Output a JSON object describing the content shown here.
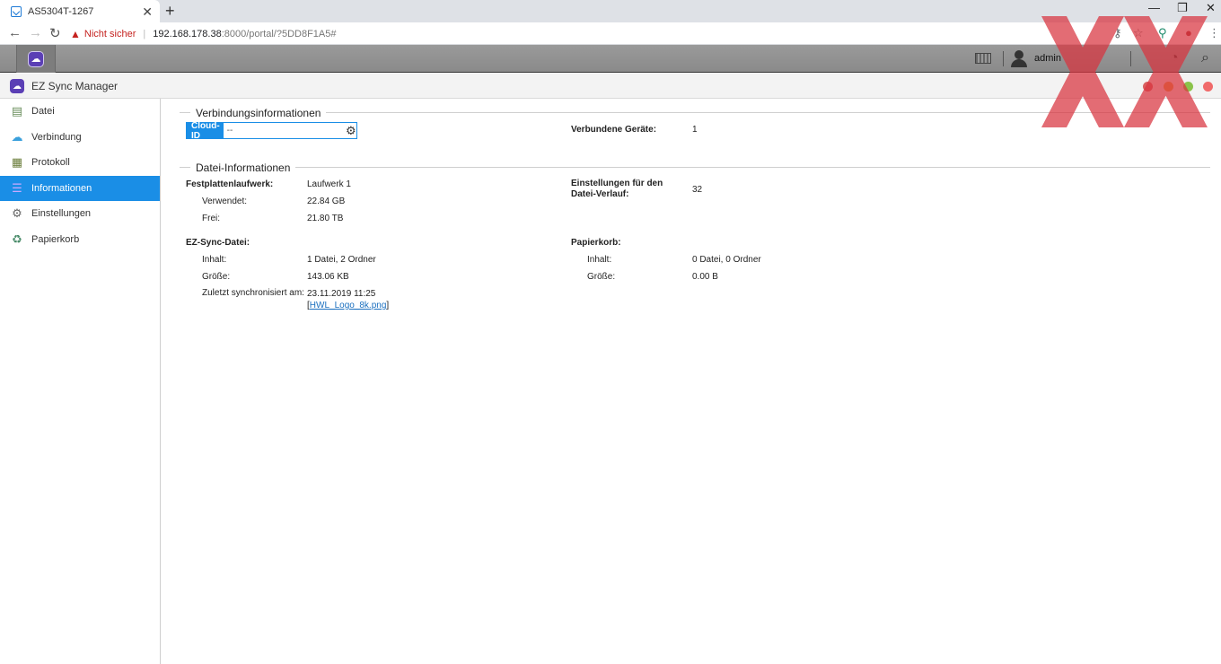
{
  "browser": {
    "tab_title": "AS5304T-1267",
    "security_label": "Nicht sicher",
    "url_host": "192.168.178.38",
    "url_path": ":8000/portal/?5DD8F1A5#"
  },
  "nas": {
    "username": "admin"
  },
  "app": {
    "title": "EZ Sync Manager"
  },
  "sidebar": {
    "items": [
      {
        "label": "Datei",
        "icon": "document-icon"
      },
      {
        "label": "Verbindung",
        "icon": "cloud-icon"
      },
      {
        "label": "Protokoll",
        "icon": "clipboard-icon"
      },
      {
        "label": "Informationen",
        "icon": "list-icon"
      },
      {
        "label": "Einstellungen",
        "icon": "gear-icon"
      },
      {
        "label": "Papierkorb",
        "icon": "recycle-icon"
      }
    ]
  },
  "connection": {
    "title": "Verbindungsinformationen",
    "cloud_id_label": "Cloud-ID",
    "cloud_id_value": "--",
    "devices_label": "Verbundene Geräte:",
    "devices_value": "1"
  },
  "file_info": {
    "title": "Datei-Informationen",
    "disk_label": "Festplattenlaufwerk:",
    "disk_value": "Laufwerk 1",
    "used_label": "Verwendet:",
    "used_value": "22.84 GB",
    "free_label": "Frei:",
    "free_value": "21.80 TB",
    "history_label": "Einstellungen für den Datei-Verlauf:",
    "history_value": "32",
    "ezsync_label": "EZ-Sync-Datei:",
    "ez_content_label": "Inhalt:",
    "ez_content_value": "1 Datei, 2 Ordner",
    "ez_size_label": "Größe:",
    "ez_size_value": "143.06 KB",
    "last_sync_label": "Zuletzt synchronisiert am:",
    "last_sync_value": "23.11.2019 11:25",
    "last_sync_file": "HWL_Logo_8k.png",
    "trash_label": "Papierkorb:",
    "trash_content_label": "Inhalt:",
    "trash_content_value": "0 Datei, 0 Ordner",
    "trash_size_label": "Größe:",
    "trash_size_value": "0.00 B"
  },
  "colors": {
    "accent": "#1a8ee6",
    "app_brand": "#5b3fb5",
    "watermark": "#d9343f"
  }
}
